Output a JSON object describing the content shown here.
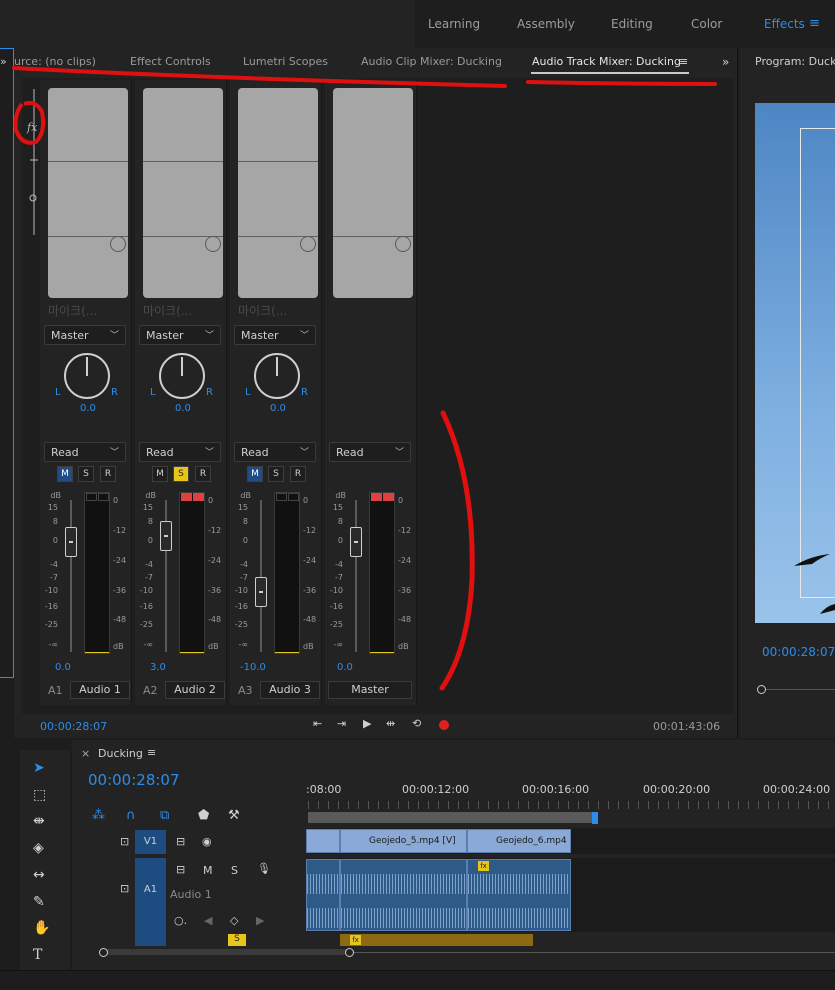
{
  "workspaces": {
    "items": [
      "Learning",
      "Assembly",
      "Editing",
      "Color",
      "Effects"
    ],
    "active": "Effects"
  },
  "tabs": {
    "source": "urce: (no clips)",
    "effect_controls": "Effect Controls",
    "lumetri": "Lumetri Scopes",
    "clip_mixer": "Audio Clip Mixer: Ducking",
    "track_mixer": "Audio Track Mixer: Ducking"
  },
  "channels": [
    {
      "mic": "마이크(...",
      "route": "Master",
      "pan": "0.0",
      "mode": "Read",
      "mute": true,
      "solo": false,
      "volume": "0.0",
      "id": "A1",
      "name": "Audio 1"
    },
    {
      "mic": "마이크(...",
      "route": "Master",
      "pan": "0.0",
      "mode": "Read",
      "mute": false,
      "solo": true,
      "volume": "3.0",
      "id": "A2",
      "name": "Audio 2"
    },
    {
      "mic": "마이크(...",
      "route": "Master",
      "pan": "0.0",
      "mode": "Read",
      "mute": true,
      "solo": false,
      "volume": "-10.0",
      "id": "A3",
      "name": "Audio 3"
    },
    {
      "mode": "Read",
      "volume": "0.0",
      "name": "Master"
    }
  ],
  "labels": {
    "L": "L",
    "R": "R",
    "M": "M",
    "S": "S",
    "R_btn": "R",
    "dB": "dB",
    "chev": "⌄"
  },
  "fader_scale": [
    "15",
    "8",
    "0",
    "-4",
    "-7",
    "-10",
    "-16",
    "-25",
    "-∞"
  ],
  "meter_scale": [
    "0",
    "-12",
    "-24",
    "-36",
    "-48",
    "dB"
  ],
  "mixer": {
    "timecode": "00:00:28:07",
    "duration": "00:01:43:06"
  },
  "program": {
    "title": "Program: Ducking",
    "timecode": "00:00:28:07"
  },
  "timeline": {
    "title": "Ducking",
    "timecode": "00:00:28:07",
    "ruler": [
      ":08:00",
      "00:00:12:00",
      "00:00:16:00",
      "00:00:20:00",
      "00:00:24:00"
    ],
    "tracks": {
      "v1": "V1",
      "a1": "A1",
      "a1_name": "Audio 1",
      "M": "M",
      "S": "S"
    },
    "clips": [
      "Geojedo_5.mp4 [V]",
      "Geojedo_6.mp4 ["
    ]
  },
  "colors": {
    "accent": "#2d8ceb",
    "solo": "#e8c51a",
    "record": "#e02020",
    "annotation": "#e01010"
  }
}
